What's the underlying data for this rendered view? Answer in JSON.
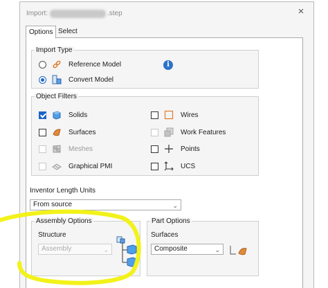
{
  "window": {
    "title_prefix": "Import:",
    "title_suffix": ".step",
    "close_glyph": "×"
  },
  "tabs": [
    {
      "label": "Options",
      "active": true
    },
    {
      "label": "Select",
      "active": false
    }
  ],
  "import_type": {
    "label": "Import Type",
    "options": [
      {
        "label": "Reference Model",
        "selected": false
      },
      {
        "label": "Convert Model",
        "selected": true
      }
    ],
    "info_glyph": "i"
  },
  "object_filters": {
    "label": "Object Filters",
    "left": [
      {
        "label": "Solids",
        "checked": true,
        "enabled": true,
        "icon": "solid-cube-icon"
      },
      {
        "label": "Surfaces",
        "checked": false,
        "enabled": true,
        "icon": "surface-icon"
      },
      {
        "label": "Meshes",
        "checked": false,
        "enabled": false,
        "icon": "mesh-icon"
      },
      {
        "label": "Graphical PMI",
        "checked": false,
        "enabled": false,
        "icon": "pmi-icon"
      }
    ],
    "right": [
      {
        "label": "Wires",
        "checked": false,
        "enabled": true,
        "icon": "wire-box-icon"
      },
      {
        "label": "Work Features",
        "checked": false,
        "enabled": false,
        "icon": "work-features-icon"
      },
      {
        "label": "Points",
        "checked": false,
        "enabled": true,
        "icon": "point-icon"
      },
      {
        "label": "UCS",
        "checked": false,
        "enabled": true,
        "icon": "ucs-icon"
      }
    ]
  },
  "length_units": {
    "label": "Inventor Length Units",
    "value": "From source"
  },
  "assembly_options": {
    "label": "Assembly Options",
    "structure_label": "Structure",
    "structure_value": "Assembly"
  },
  "part_options": {
    "label": "Part Options",
    "surfaces_label": "Surfaces",
    "surfaces_value": "Composite"
  },
  "colors": {
    "accent": "#1e64c8",
    "highlight": "#f2f21a"
  }
}
